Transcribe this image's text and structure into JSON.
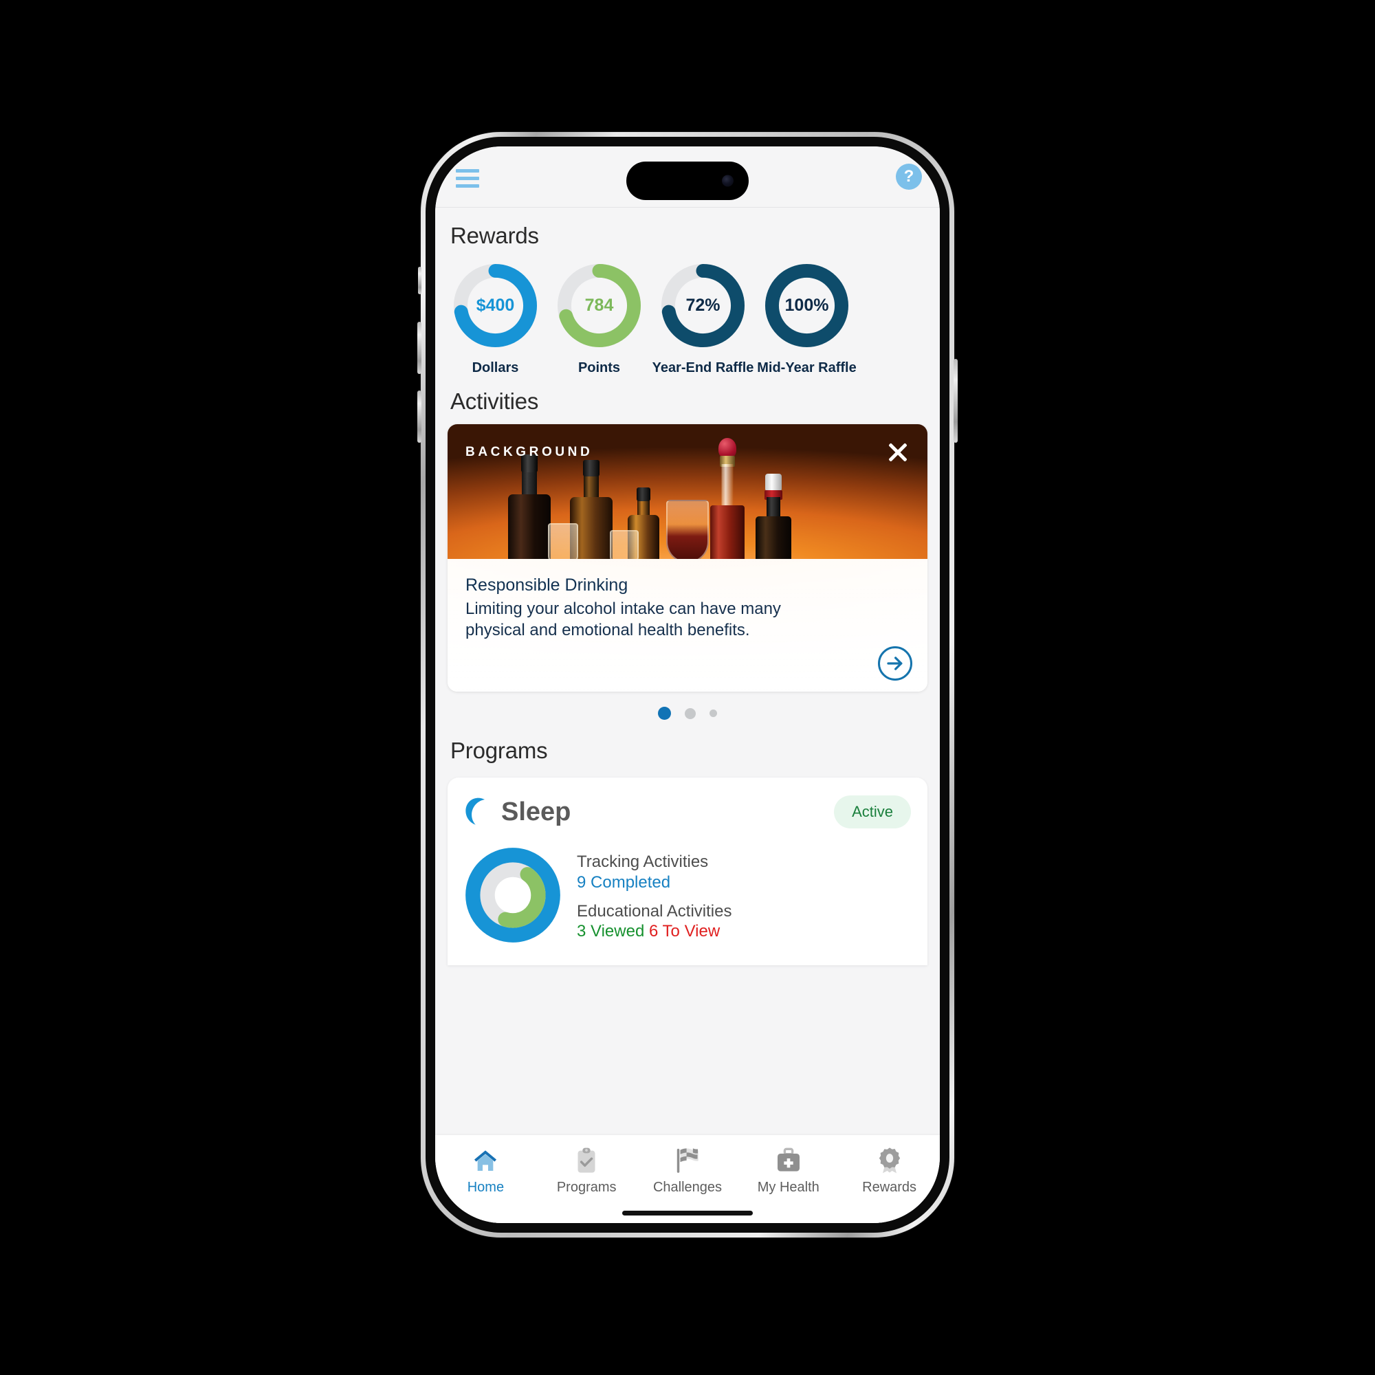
{
  "app": {
    "menu_icon": "hamburger-menu-icon",
    "help_icon": "help-question-icon",
    "help_label": "?"
  },
  "rewards": {
    "title": "Rewards",
    "rings": [
      {
        "value": "$400",
        "label": "Dollars",
        "percent": 72,
        "color": "#1794d6",
        "track": "#e3e4e6",
        "text_color": "#1794d6"
      },
      {
        "value": "784",
        "label": "Points",
        "percent": 70,
        "color": "#8cc265",
        "track": "#e3e4e6",
        "text_color": "#7cb85a"
      },
      {
        "value": "72%",
        "label": "Year-End Raffle",
        "percent": 72,
        "color": "#0e4c6b",
        "track": "#e3e4e6",
        "text_color": "#0e2a47"
      },
      {
        "value": "100%",
        "label": "Mid-Year Raffle",
        "percent": 100,
        "color": "#0e4c6b",
        "track": "#e3e4e6",
        "text_color": "#0e2a47"
      }
    ]
  },
  "activities": {
    "title": "Activities",
    "card": {
      "kicker": "BACKGROUND",
      "close_icon": "close-x-icon",
      "title": "Responsible Drinking",
      "description": "Limiting your alcohol intake can have many physical and emotional health benefits.",
      "arrow_icon": "arrow-right-icon",
      "hero_alt": "assorted alcohol bottles and glasses on orange background"
    },
    "carousel": {
      "total": 3,
      "active_index": 0
    }
  },
  "programs": {
    "title": "Programs",
    "items": [
      {
        "icon": "moon-icon",
        "name": "Sleep",
        "status": "Active",
        "status_color": "#1a7f3c",
        "ring": {
          "outer_percent": 100,
          "outer_color": "#1794d6",
          "inner_percent": 45,
          "inner_color": "#8cc265"
        },
        "stats": [
          {
            "label": "Tracking Activities",
            "parts": [
              {
                "text": "9 Completed",
                "color": "#1781c2"
              }
            ]
          },
          {
            "label": "Educational Activities",
            "parts": [
              {
                "text": "3 Viewed ",
                "color": "#17912f"
              },
              {
                "text": "6 To View",
                "color": "#e02020"
              }
            ]
          }
        ]
      }
    ]
  },
  "tabbar": {
    "items": [
      {
        "id": "home",
        "label": "Home",
        "icon": "home-icon",
        "active": true
      },
      {
        "id": "programs",
        "label": "Programs",
        "icon": "clipboard-check-icon",
        "active": false
      },
      {
        "id": "challenges",
        "label": "Challenges",
        "icon": "checkered-flag-icon",
        "active": false
      },
      {
        "id": "myhealth",
        "label": "My Health",
        "icon": "medical-bag-icon",
        "active": false
      },
      {
        "id": "rewards",
        "label": "Rewards",
        "icon": "award-ribbon-icon",
        "active": false
      }
    ]
  },
  "colors": {
    "accent_blue": "#1794d6",
    "deep_navy": "#0e4c6b",
    "green": "#8cc265",
    "bg": "#f5f5f6"
  }
}
